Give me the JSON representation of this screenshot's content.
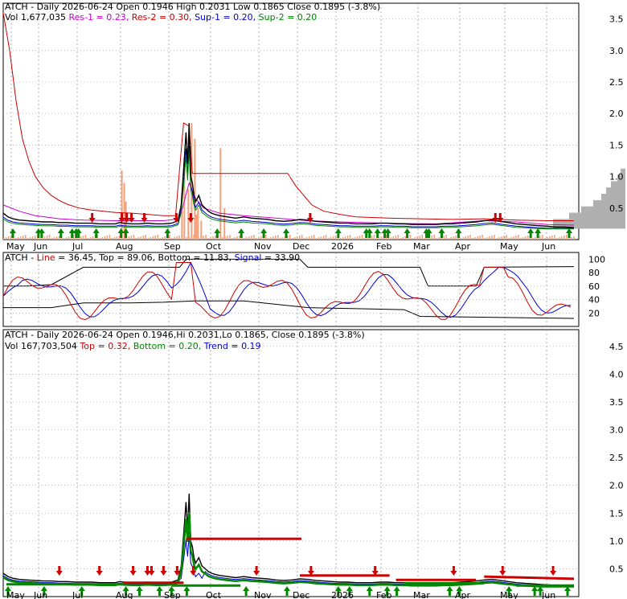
{
  "chart_data": {
    "type": "line",
    "colors": {
      "price": "#000000",
      "resistance": "#cc0000",
      "res2": "#cc00cc",
      "support": "#0000cc",
      "sup2": "#008800",
      "volume": "#f4a07a",
      "line_ind": "#cc0000",
      "signal": "#0000cc",
      "top_band": "#000000",
      "grid": "#999999",
      "bg": "#ffffff"
    },
    "x_labels_top": [
      "May",
      "Jun",
      "Jul",
      "Aug",
      "Sep",
      "Oct",
      "Nov",
      "Dec",
      "2026",
      "Feb",
      "Mar",
      "Apr",
      "May",
      "Jun"
    ],
    "x_labels_bottom": [
      "May",
      "Jun",
      "Jul",
      "Aug",
      "Sep",
      "Oct",
      "Nov",
      "Dec",
      "2026",
      "Feb",
      "Mar",
      "Apr",
      "May",
      "Jun"
    ],
    "panel1": {
      "title": "ATCH - Daily 2026-06-24 Open 0.1946  High 0.2031  Low 0.1865  Close 0.1895 (-3.8%)",
      "legend": [
        {
          "text": "Vol 1,677,035",
          "color": "#000000"
        },
        {
          "text": "Res-1 = 0.23,",
          "color": "#cc00cc"
        },
        {
          "text": "Res-2 = 0.30,",
          "color": "#cc0000"
        },
        {
          "text": "Sup-1 = 0.20,",
          "color": "#0000cc"
        },
        {
          "text": "Sup-2 = 0.20",
          "color": "#008800"
        }
      ],
      "y_ticks": [
        0.5,
        1.0,
        1.5,
        2.0,
        2.5,
        3.0,
        3.5
      ],
      "ylim": [
        0.0,
        3.75
      ]
    },
    "panel2": {
      "title": "ATCH - Line = 36.45, Top = 89.06, Bottom = 11.83, Signal = 33.90",
      "title_parts": [
        {
          "text": "ATCH - ",
          "color": "#000000"
        },
        {
          "text": "Line",
          "color": "#cc0000"
        },
        {
          "text": " = 36.45, Top = 89.06, Bottom = 11.83, ",
          "color": "#000000"
        },
        {
          "text": "Signal",
          "color": "#0000cc"
        },
        {
          "text": " = 33.90",
          "color": "#000000"
        }
      ],
      "y_ticks": [
        20,
        40,
        60,
        80,
        100
      ],
      "ylim": [
        0,
        110
      ]
    },
    "panel3": {
      "title": "ATCH - Daily 2026-06-24 Open 0.1946,Hi 0.2031,Lo 0.1865, Close 0.1895 (-3.8%)",
      "legend": [
        {
          "text": "Vol 167,703,504",
          "color": "#000000"
        },
        {
          "text": "Top = 0.32,",
          "color": "#cc0000"
        },
        {
          "text": "Bottom = 0.20,",
          "color": "#008800"
        },
        {
          "text": "Trend = 0.19",
          "color": "#0000cc"
        }
      ],
      "y_ticks": [
        0.5,
        1.0,
        1.5,
        2.0,
        2.5,
        3.0,
        3.5,
        4.0,
        4.5
      ],
      "ylim": [
        0.0,
        4.8
      ]
    },
    "price_series": [
      [
        0,
        0.42
      ],
      [
        6,
        0.36
      ],
      [
        12,
        0.33
      ],
      [
        20,
        0.31
      ],
      [
        30,
        0.3
      ],
      [
        40,
        0.29
      ],
      [
        50,
        0.28
      ],
      [
        60,
        0.28
      ],
      [
        70,
        0.27
      ],
      [
        80,
        0.27
      ],
      [
        90,
        0.26
      ],
      [
        100,
        0.26
      ],
      [
        110,
        0.26
      ],
      [
        120,
        0.25
      ],
      [
        130,
        0.25
      ],
      [
        140,
        0.25
      ],
      [
        145,
        0.27
      ],
      [
        150,
        0.26
      ],
      [
        160,
        0.25
      ],
      [
        170,
        0.25
      ],
      [
        180,
        0.26
      ],
      [
        190,
        0.25
      ],
      [
        200,
        0.25
      ],
      [
        210,
        0.26
      ],
      [
        218,
        0.3
      ],
      [
        222,
        0.55
      ],
      [
        226,
        1.3
      ],
      [
        228,
        1.7
      ],
      [
        230,
        1.2
      ],
      [
        232,
        1.85
      ],
      [
        234,
        1.0
      ],
      [
        236,
        0.9
      ],
      [
        238,
        0.7
      ],
      [
        240,
        0.6
      ],
      [
        244,
        0.7
      ],
      [
        248,
        0.55
      ],
      [
        252,
        0.5
      ],
      [
        256,
        0.45
      ],
      [
        260,
        0.42
      ],
      [
        264,
        0.4
      ],
      [
        270,
        0.38
      ],
      [
        280,
        0.36
      ],
      [
        290,
        0.34
      ],
      [
        300,
        0.36
      ],
      [
        310,
        0.34
      ],
      [
        320,
        0.33
      ],
      [
        330,
        0.32
      ],
      [
        340,
        0.3
      ],
      [
        350,
        0.29
      ],
      [
        360,
        0.3
      ],
      [
        370,
        0.32
      ],
      [
        380,
        0.31
      ],
      [
        390,
        0.29
      ],
      [
        400,
        0.28
      ],
      [
        410,
        0.27
      ],
      [
        420,
        0.26
      ],
      [
        430,
        0.26
      ],
      [
        440,
        0.25
      ],
      [
        450,
        0.25
      ],
      [
        460,
        0.25
      ],
      [
        470,
        0.26
      ],
      [
        480,
        0.26
      ],
      [
        490,
        0.25
      ],
      [
        500,
        0.25
      ],
      [
        510,
        0.24
      ],
      [
        520,
        0.24
      ],
      [
        530,
        0.24
      ],
      [
        540,
        0.24
      ],
      [
        550,
        0.25
      ],
      [
        560,
        0.25
      ],
      [
        570,
        0.26
      ],
      [
        580,
        0.27
      ],
      [
        590,
        0.28
      ],
      [
        600,
        0.3
      ],
      [
        610,
        0.31
      ],
      [
        620,
        0.29
      ],
      [
        630,
        0.27
      ],
      [
        640,
        0.25
      ],
      [
        650,
        0.24
      ],
      [
        660,
        0.23
      ],
      [
        670,
        0.22
      ],
      [
        680,
        0.21
      ],
      [
        690,
        0.2
      ],
      [
        700,
        0.2
      ],
      [
        712,
        0.19
      ]
    ],
    "res2_line": [
      [
        0,
        3.6
      ],
      [
        8,
        3.0
      ],
      [
        16,
        2.2
      ],
      [
        24,
        1.6
      ],
      [
        32,
        1.25
      ],
      [
        40,
        1.0
      ],
      [
        50,
        0.82
      ],
      [
        60,
        0.7
      ],
      [
        70,
        0.62
      ],
      [
        80,
        0.56
      ],
      [
        95,
        0.5
      ],
      [
        110,
        0.47
      ],
      [
        125,
        0.45
      ],
      [
        140,
        0.43
      ],
      [
        160,
        0.42
      ],
      [
        180,
        0.4
      ],
      [
        200,
        0.38
      ],
      [
        215,
        0.38
      ],
      [
        225,
        1.85
      ],
      [
        232,
        1.8
      ],
      [
        236,
        1.05
      ],
      [
        300,
        1.05
      ],
      [
        355,
        1.05
      ],
      [
        365,
        0.85
      ],
      [
        375,
        0.7
      ],
      [
        385,
        0.55
      ],
      [
        400,
        0.45
      ],
      [
        420,
        0.4
      ],
      [
        440,
        0.36
      ],
      [
        480,
        0.34
      ],
      [
        520,
        0.33
      ],
      [
        560,
        0.32
      ],
      [
        600,
        0.33
      ],
      [
        640,
        0.31
      ],
      [
        680,
        0.3
      ],
      [
        712,
        0.3
      ]
    ],
    "res1_line": [
      [
        0,
        0.55
      ],
      [
        20,
        0.45
      ],
      [
        40,
        0.38
      ],
      [
        70,
        0.33
      ],
      [
        100,
        0.31
      ],
      [
        140,
        0.3
      ],
      [
        200,
        0.3
      ],
      [
        220,
        0.33
      ],
      [
        232,
        0.9
      ],
      [
        240,
        0.65
      ],
      [
        250,
        0.5
      ],
      [
        270,
        0.42
      ],
      [
        300,
        0.38
      ],
      [
        340,
        0.34
      ],
      [
        380,
        0.3
      ],
      [
        420,
        0.28
      ],
      [
        480,
        0.26
      ],
      [
        540,
        0.25
      ],
      [
        600,
        0.3
      ],
      [
        640,
        0.28
      ],
      [
        680,
        0.24
      ],
      [
        712,
        0.23
      ]
    ],
    "volume_spikes": [
      [
        147,
        1.1
      ],
      [
        150,
        0.9
      ],
      [
        152,
        0.6
      ],
      [
        234,
        1.85
      ],
      [
        238,
        1.6
      ],
      [
        240,
        0.4
      ],
      [
        242,
        0.5
      ],
      [
        246,
        0.3
      ],
      [
        270,
        1.45
      ],
      [
        275,
        0.5
      ],
      [
        225,
        1.3
      ],
      [
        222,
        0.45
      ],
      [
        230,
        0.8
      ]
    ],
    "red_arrows_top": [
      111,
      148,
      154,
      160,
      176,
      216,
      234,
      383,
      614,
      620
    ],
    "green_arrows_top": [
      12,
      44,
      48,
      72,
      86,
      91,
      94,
      116,
      147,
      153,
      205,
      267,
      297,
      325,
      353,
      418,
      453,
      457,
      467,
      476,
      480,
      504,
      528,
      531,
      547,
      568,
      658,
      667,
      706
    ],
    "red_arrows_bottom": [
      70,
      120,
      162,
      180,
      185,
      200,
      217,
      237,
      316,
      384,
      464,
      562,
      623,
      686
    ],
    "green_arrows_bottom": [
      6,
      51,
      98,
      153,
      170,
      195,
      210,
      229,
      303,
      354,
      418,
      432,
      457,
      479,
      491,
      557,
      569,
      631,
      663,
      670,
      704
    ]
  }
}
